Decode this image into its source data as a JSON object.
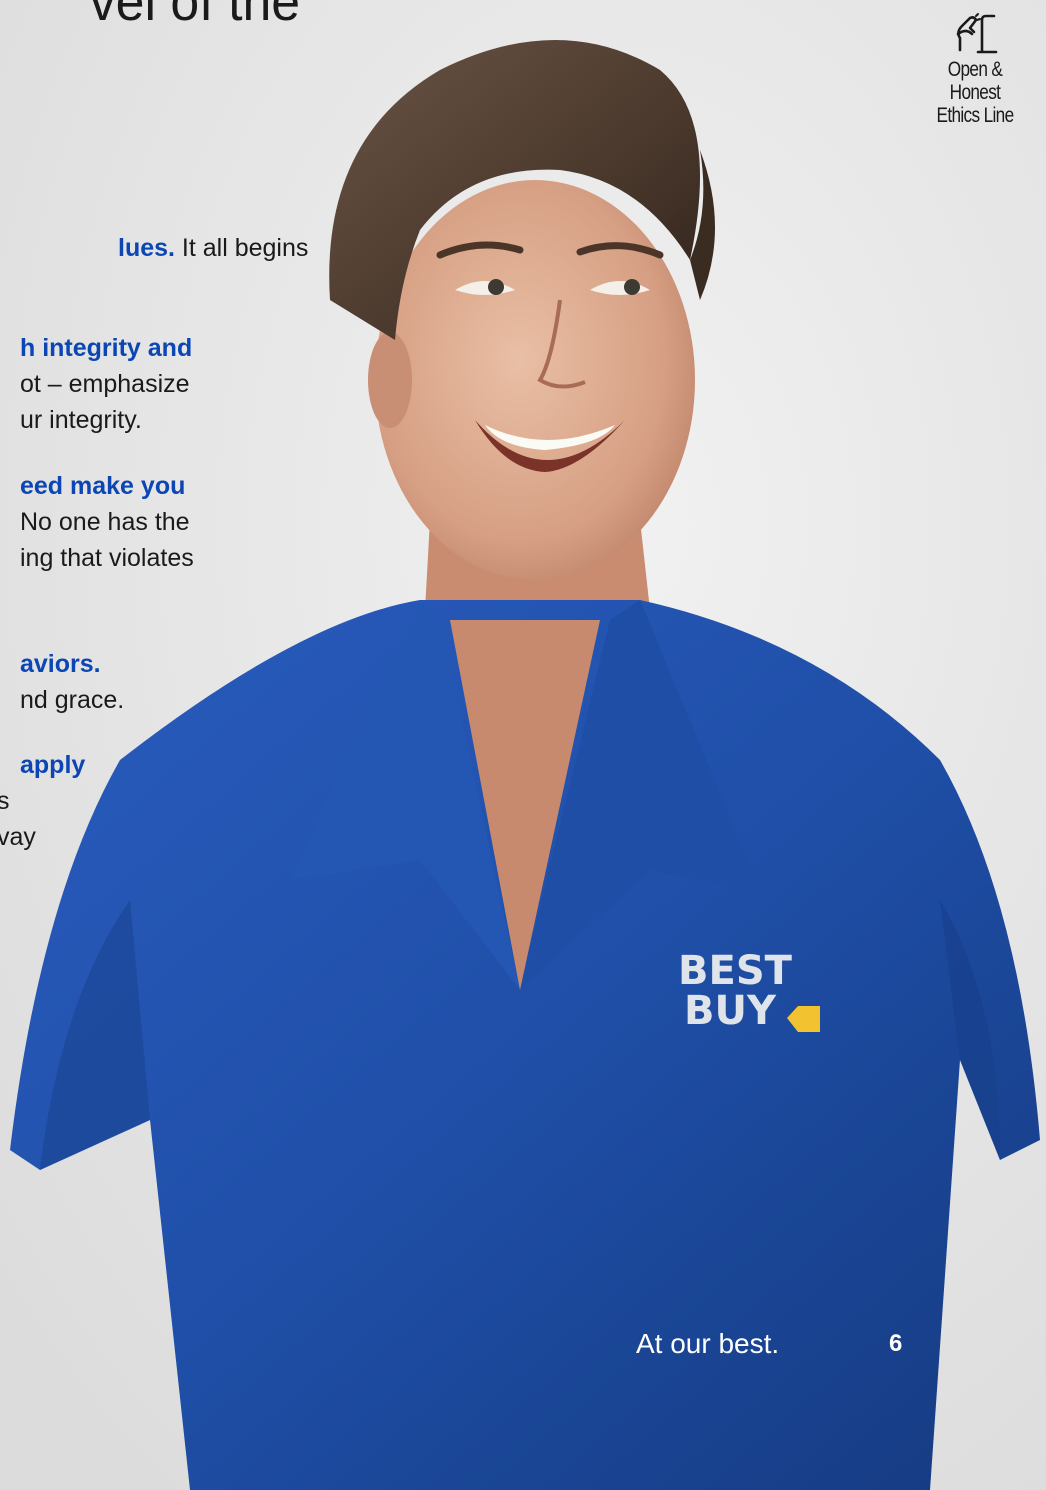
{
  "headline": {
    "text": "vel of the"
  },
  "paragraphs": [
    {
      "strong": "lues.",
      "rest": " It all begins"
    },
    {
      "strong": "h integrity and",
      "rest": ""
    },
    {
      "strong": "",
      "rest": "ot – emphasize"
    },
    {
      "strong": "",
      "rest": "ur integrity."
    },
    {
      "strong": "eed make you",
      "rest": ""
    },
    {
      "strong": "",
      "rest": "No one has the"
    },
    {
      "strong": "",
      "rest": "ing that violates"
    },
    {
      "strong": "aviors.",
      "rest": ""
    },
    {
      "strong": "",
      "rest": "nd grace."
    },
    {
      "strong": "apply",
      "rest": ""
    },
    {
      "strong": "",
      "rest": "s"
    },
    {
      "strong": "",
      "rest": "vay"
    }
  ],
  "ethics_line": {
    "icon": "phone-hand-icon",
    "line1": "Open &",
    "line2": "Honest",
    "line3": "Ethics Line"
  },
  "shirt_logo": {
    "line1": "BEST",
    "line2": "BUY"
  },
  "footer": {
    "tagline": "At our best.",
    "page_number": "6"
  },
  "colors": {
    "accent": "#0b46b4",
    "shirt": "#1f4fa8",
    "logo_tag": "#f2c230"
  }
}
